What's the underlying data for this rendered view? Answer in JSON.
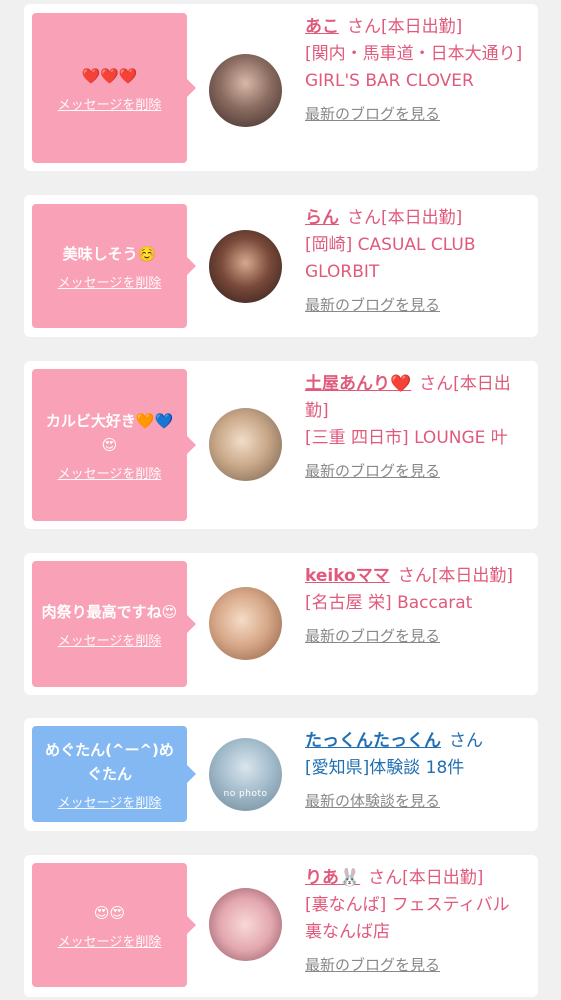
{
  "colors": {
    "pink": "#f9a1b6",
    "blue": "#83b8f2",
    "pink_text": "#e05a7c",
    "blue_text": "#1f6fb2"
  },
  "cards": [
    {
      "message": "❤️❤️❤️",
      "delete_label": "メッセージを削除",
      "name": "あこ",
      "suffix": "さん[本日出勤]",
      "shop": "[関内・馬車道・日本大通り] GIRL'S BAR CLOVER",
      "link": "最新のブログを見る",
      "avatar_icon": "profile-photo"
    },
    {
      "message": "美味しそう☺️",
      "delete_label": "メッセージを削除",
      "name": "らん",
      "suffix": "さん[本日出勤]",
      "shop": "[岡崎] CASUAL CLUB GLORBIT",
      "link": "最新のブログを見る",
      "avatar_icon": "profile-photo"
    },
    {
      "message": "カルビ大好き🧡💙😍",
      "delete_label": "メッセージを削除",
      "name": "土屋あんり❤️",
      "suffix": "さん[本日出勤]",
      "shop": "[三重 四日市] LOUNGE 叶",
      "link": "最新のブログを見る",
      "avatar_icon": "profile-photo"
    },
    {
      "message": "肉祭り最高ですね😍",
      "delete_label": "メッセージを削除",
      "name": "keikoママ",
      "suffix": "さん[本日出勤]",
      "shop": "[名古屋 栄] Baccarat",
      "link": "最新のブログを見る",
      "avatar_icon": "profile-photo"
    },
    {
      "message": "めぐたん(^ー^)めぐたん",
      "delete_label": "メッセージを削除",
      "name": "たっくんたっくん",
      "suffix": "さん",
      "shop": "[愛知県]体験談 18件",
      "link": "最新の体験談を見る",
      "avatar_icon": "no-photo",
      "avatar_text": "no photo"
    },
    {
      "message": "😍😍",
      "delete_label": "メッセージを削除",
      "name": "りあ🐰",
      "suffix": "さん[本日出勤]",
      "shop": "[裏なんば] フェスティバル 裏なんば店",
      "link": "最新のブログを見る",
      "avatar_icon": "profile-photo"
    }
  ]
}
